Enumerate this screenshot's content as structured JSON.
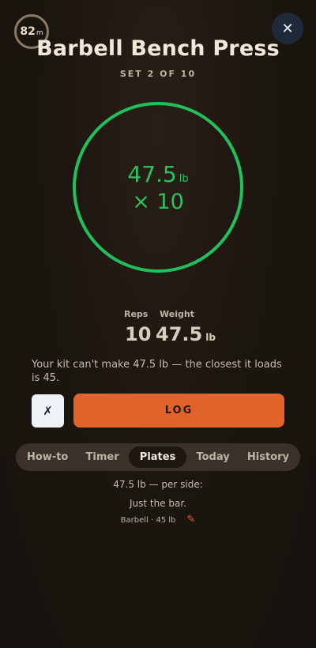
{
  "timer": {
    "value": "82",
    "unit": "m"
  },
  "close": {
    "icon": "close-icon",
    "glyph": "✕"
  },
  "exercise": {
    "title": "Barbell Bench Press",
    "set_label": "SET 2 OF 10"
  },
  "target": {
    "weight": "47.5",
    "weight_unit": "lb",
    "reps": "× 10",
    "ring_color": "#22c05c"
  },
  "stats": {
    "reps_label": "Reps",
    "reps_value": "10",
    "weight_label": "Weight",
    "weight_value": "47.5",
    "weight_unit": "lb"
  },
  "warning": "Your kit can't make 47.5 lb — the closest it loads is 45.",
  "actions": {
    "dismiss_label": "✗",
    "log_label": "LOG",
    "log_color": "#e0632c"
  },
  "tabs": [
    {
      "label": "How-to"
    },
    {
      "label": "Timer"
    },
    {
      "label": "Plates",
      "active": true
    },
    {
      "label": "Today"
    },
    {
      "label": "History"
    }
  ],
  "plates": {
    "per_side": "47.5 lb — per side:",
    "result": "Just the bar.",
    "bar_info": "Barbell · 45 lb",
    "edit_icon": "pencil-icon"
  }
}
